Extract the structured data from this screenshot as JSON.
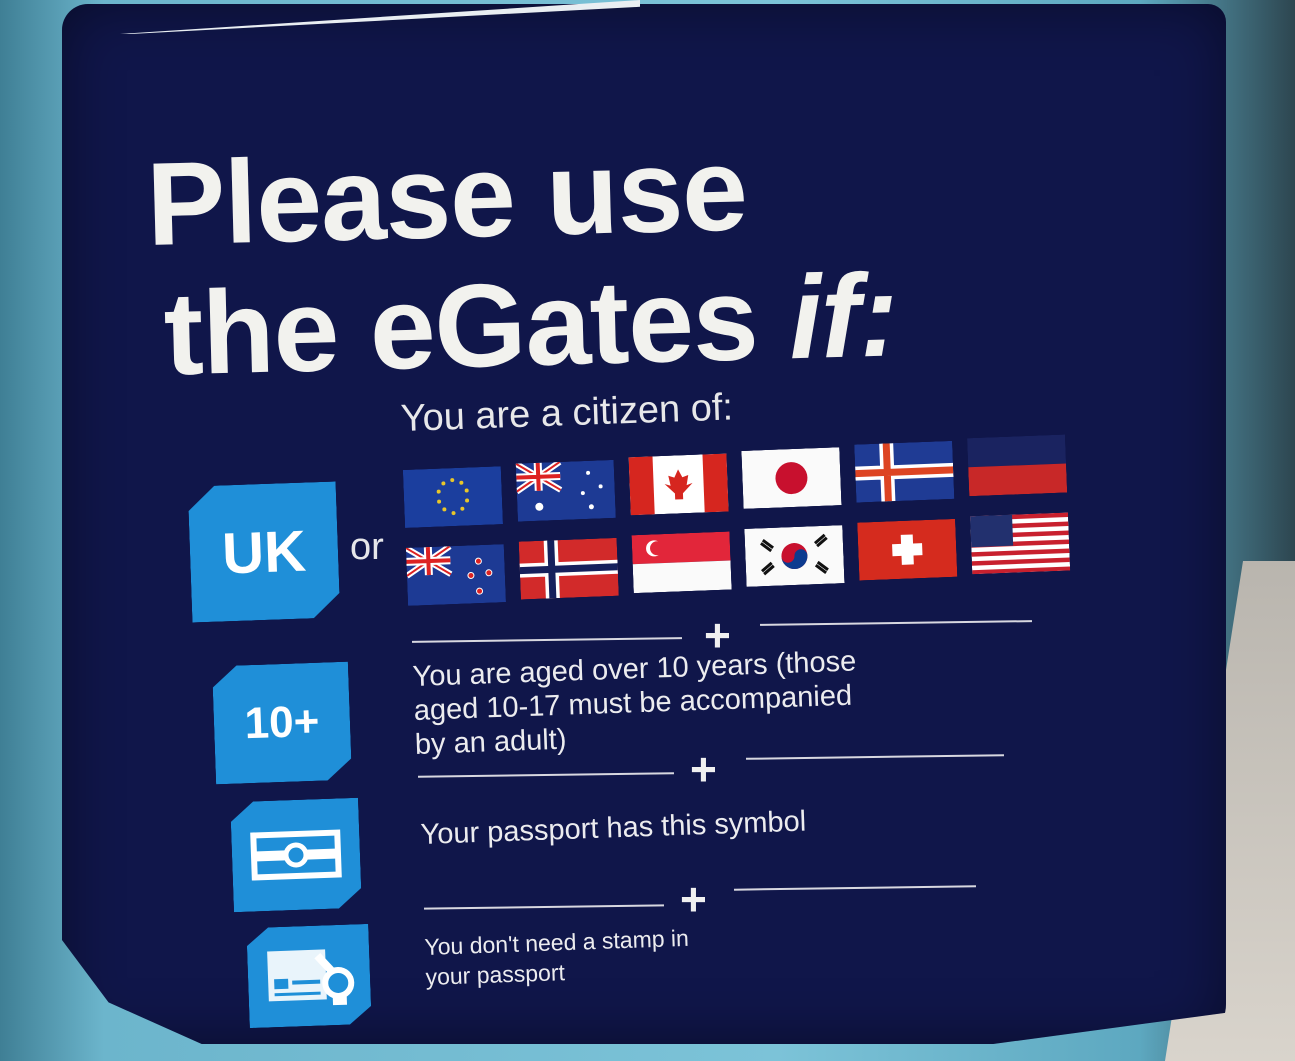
{
  "sign": {
    "title_line1": "Please use",
    "title_line2_main": "the eGates ",
    "title_line2_italic": "if:",
    "subtitle": "You are a citizen of:",
    "or_text": "or",
    "badges": {
      "uk": "UK",
      "age": "10+"
    },
    "flags": [
      {
        "country": "European Union",
        "icon": "eu-flag-icon"
      },
      {
        "country": "Australia",
        "icon": "australia-flag-icon"
      },
      {
        "country": "Canada",
        "icon": "canada-flag-icon"
      },
      {
        "country": "Japan",
        "icon": "japan-flag-icon"
      },
      {
        "country": "Iceland",
        "icon": "iceland-flag-icon"
      },
      {
        "country": "Liechtenstein",
        "icon": "liechtenstein-flag-icon"
      },
      {
        "country": "New Zealand",
        "icon": "new-zealand-flag-icon"
      },
      {
        "country": "Norway",
        "icon": "norway-flag-icon"
      },
      {
        "country": "Singapore",
        "icon": "singapore-flag-icon"
      },
      {
        "country": "South Korea",
        "icon": "south-korea-flag-icon"
      },
      {
        "country": "Switzerland",
        "icon": "switzerland-flag-icon"
      },
      {
        "country": "United States",
        "icon": "usa-flag-icon"
      }
    ],
    "separator": "+",
    "conditions": {
      "age_line1": "You are aged over 10 years (those",
      "age_line2": "aged 10-17 must be accompanied",
      "age_line3": "by an adult)",
      "passport": "Your passport has this symbol",
      "stamp_line1": "You don't need a stamp in",
      "stamp_line2": "your passport"
    }
  },
  "colors": {
    "sign_background": "#10164a",
    "badge_blue": "#1f8fd8",
    "surround_blue": "#7cc3d8",
    "text_white": "#f2f2ee"
  }
}
